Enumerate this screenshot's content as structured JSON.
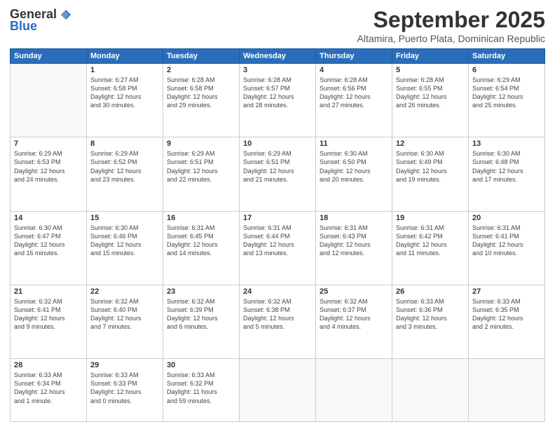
{
  "header": {
    "logo": {
      "general": "General",
      "blue": "Blue"
    },
    "title": "September 2025",
    "subtitle": "Altamira, Puerto Plata, Dominican Republic"
  },
  "weekdays": [
    "Sunday",
    "Monday",
    "Tuesday",
    "Wednesday",
    "Thursday",
    "Friday",
    "Saturday"
  ],
  "weeks": [
    [
      {
        "day": "",
        "content": ""
      },
      {
        "day": "1",
        "content": "Sunrise: 6:27 AM\nSunset: 6:58 PM\nDaylight: 12 hours\nand 30 minutes."
      },
      {
        "day": "2",
        "content": "Sunrise: 6:28 AM\nSunset: 6:58 PM\nDaylight: 12 hours\nand 29 minutes."
      },
      {
        "day": "3",
        "content": "Sunrise: 6:28 AM\nSunset: 6:57 PM\nDaylight: 12 hours\nand 28 minutes."
      },
      {
        "day": "4",
        "content": "Sunrise: 6:28 AM\nSunset: 6:56 PM\nDaylight: 12 hours\nand 27 minutes."
      },
      {
        "day": "5",
        "content": "Sunrise: 6:28 AM\nSunset: 6:55 PM\nDaylight: 12 hours\nand 26 minutes."
      },
      {
        "day": "6",
        "content": "Sunrise: 6:29 AM\nSunset: 6:54 PM\nDaylight: 12 hours\nand 25 minutes."
      }
    ],
    [
      {
        "day": "7",
        "content": "Sunrise: 6:29 AM\nSunset: 6:53 PM\nDaylight: 12 hours\nand 24 minutes."
      },
      {
        "day": "8",
        "content": "Sunrise: 6:29 AM\nSunset: 6:52 PM\nDaylight: 12 hours\nand 23 minutes."
      },
      {
        "day": "9",
        "content": "Sunrise: 6:29 AM\nSunset: 6:51 PM\nDaylight: 12 hours\nand 22 minutes."
      },
      {
        "day": "10",
        "content": "Sunrise: 6:29 AM\nSunset: 6:51 PM\nDaylight: 12 hours\nand 21 minutes."
      },
      {
        "day": "11",
        "content": "Sunrise: 6:30 AM\nSunset: 6:50 PM\nDaylight: 12 hours\nand 20 minutes."
      },
      {
        "day": "12",
        "content": "Sunrise: 6:30 AM\nSunset: 6:49 PM\nDaylight: 12 hours\nand 19 minutes."
      },
      {
        "day": "13",
        "content": "Sunrise: 6:30 AM\nSunset: 6:48 PM\nDaylight: 12 hours\nand 17 minutes."
      }
    ],
    [
      {
        "day": "14",
        "content": "Sunrise: 6:30 AM\nSunset: 6:47 PM\nDaylight: 12 hours\nand 16 minutes."
      },
      {
        "day": "15",
        "content": "Sunrise: 6:30 AM\nSunset: 6:46 PM\nDaylight: 12 hours\nand 15 minutes."
      },
      {
        "day": "16",
        "content": "Sunrise: 6:31 AM\nSunset: 6:45 PM\nDaylight: 12 hours\nand 14 minutes."
      },
      {
        "day": "17",
        "content": "Sunrise: 6:31 AM\nSunset: 6:44 PM\nDaylight: 12 hours\nand 13 minutes."
      },
      {
        "day": "18",
        "content": "Sunrise: 6:31 AM\nSunset: 6:43 PM\nDaylight: 12 hours\nand 12 minutes."
      },
      {
        "day": "19",
        "content": "Sunrise: 6:31 AM\nSunset: 6:42 PM\nDaylight: 12 hours\nand 11 minutes."
      },
      {
        "day": "20",
        "content": "Sunrise: 6:31 AM\nSunset: 6:41 PM\nDaylight: 12 hours\nand 10 minutes."
      }
    ],
    [
      {
        "day": "21",
        "content": "Sunrise: 6:32 AM\nSunset: 6:41 PM\nDaylight: 12 hours\nand 9 minutes."
      },
      {
        "day": "22",
        "content": "Sunrise: 6:32 AM\nSunset: 6:40 PM\nDaylight: 12 hours\nand 7 minutes."
      },
      {
        "day": "23",
        "content": "Sunrise: 6:32 AM\nSunset: 6:39 PM\nDaylight: 12 hours\nand 6 minutes."
      },
      {
        "day": "24",
        "content": "Sunrise: 6:32 AM\nSunset: 6:38 PM\nDaylight: 12 hours\nand 5 minutes."
      },
      {
        "day": "25",
        "content": "Sunrise: 6:32 AM\nSunset: 6:37 PM\nDaylight: 12 hours\nand 4 minutes."
      },
      {
        "day": "26",
        "content": "Sunrise: 6:33 AM\nSunset: 6:36 PM\nDaylight: 12 hours\nand 3 minutes."
      },
      {
        "day": "27",
        "content": "Sunrise: 6:33 AM\nSunset: 6:35 PM\nDaylight: 12 hours\nand 2 minutes."
      }
    ],
    [
      {
        "day": "28",
        "content": "Sunrise: 6:33 AM\nSunset: 6:34 PM\nDaylight: 12 hours\nand 1 minute."
      },
      {
        "day": "29",
        "content": "Sunrise: 6:33 AM\nSunset: 6:33 PM\nDaylight: 12 hours\nand 0 minutes."
      },
      {
        "day": "30",
        "content": "Sunrise: 6:33 AM\nSunset: 6:32 PM\nDaylight: 11 hours\nand 59 minutes."
      },
      {
        "day": "",
        "content": ""
      },
      {
        "day": "",
        "content": ""
      },
      {
        "day": "",
        "content": ""
      },
      {
        "day": "",
        "content": ""
      }
    ]
  ]
}
